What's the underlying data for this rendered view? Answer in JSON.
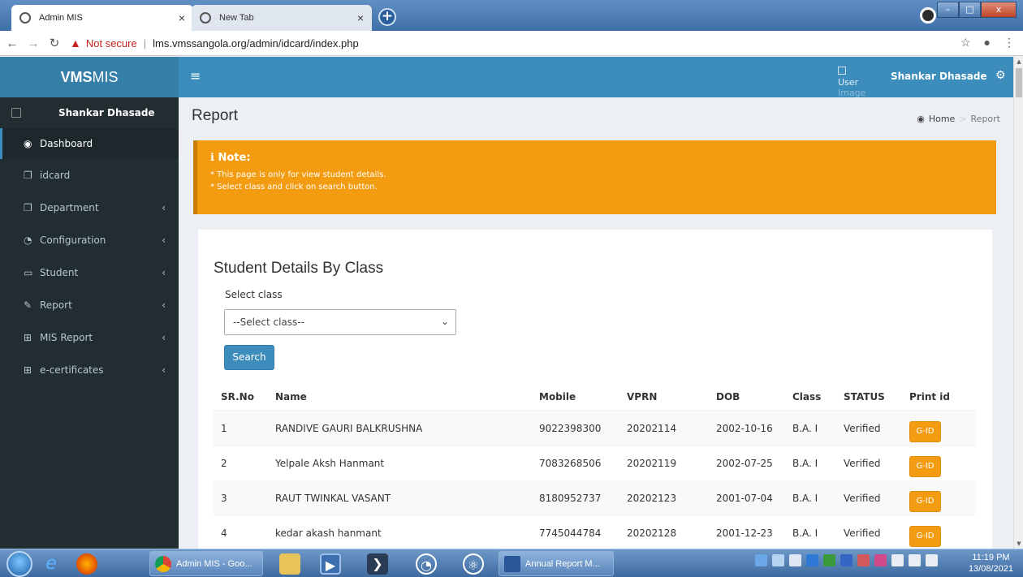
{
  "browser": {
    "tabs": [
      {
        "title": "Admin MIS",
        "active": true
      },
      {
        "title": "New Tab",
        "active": false
      }
    ],
    "address": {
      "security_label": "Not secure",
      "url": "lms.vmssangola.org/admin/idcard/index.php"
    }
  },
  "app": {
    "logo_bold": "VMS",
    "logo_rest": "MIS",
    "navbar": {
      "user_image_alt_1": "User",
      "user_image_alt_2": "Image",
      "user_name": "Shankar Dhasade"
    }
  },
  "sidebar": {
    "user_name": "Shankar Dhasade",
    "items": [
      {
        "label": "Dashboard",
        "icon": "dashboard-icon",
        "glyph": "◉",
        "active": true,
        "chevron": false
      },
      {
        "label": "idcard",
        "icon": "copy-icon",
        "glyph": "❐",
        "active": false,
        "chevron": false
      },
      {
        "label": "Department",
        "icon": "copy-icon",
        "glyph": "❐",
        "active": false,
        "chevron": true
      },
      {
        "label": "Configuration",
        "icon": "pie-chart-icon",
        "glyph": "◔",
        "active": false,
        "chevron": true
      },
      {
        "label": "Student",
        "icon": "laptop-icon",
        "glyph": "▭",
        "active": false,
        "chevron": true
      },
      {
        "label": "Report",
        "icon": "edit-icon",
        "glyph": "✎",
        "active": false,
        "chevron": true
      },
      {
        "label": "MIS Report",
        "icon": "table-icon",
        "glyph": "⊞",
        "active": false,
        "chevron": true
      },
      {
        "label": "e-certificates",
        "icon": "table-icon",
        "glyph": "⊞",
        "active": false,
        "chevron": true
      }
    ]
  },
  "page": {
    "title": "Report",
    "breadcrumb": {
      "home": "Home",
      "current": "Report"
    }
  },
  "note": {
    "title": "Note:",
    "lines": [
      "* This page is only for view student details.",
      "* Select class and click on search button."
    ]
  },
  "box": {
    "title": "Student Details By Class",
    "select_label": "Select class",
    "select_value": "--Select class--",
    "search_button": "Search"
  },
  "table": {
    "headers": [
      "SR.No",
      "Name",
      "Mobile",
      "VPRN",
      "DOB",
      "Class",
      "STATUS",
      "Print id"
    ],
    "rows": [
      {
        "sr": "1",
        "name": "RANDIVE GAURI BALKRUSHNA",
        "mobile": "9022398300",
        "vprn": "20202114",
        "dob": "2002-10-16",
        "class": "B.A. I",
        "status": "Verified",
        "action": "G-ID"
      },
      {
        "sr": "2",
        "name": "Yelpale Aksh Hanmant",
        "mobile": "7083268506",
        "vprn": "20202119",
        "dob": "2002-07-25",
        "class": "B.A. I",
        "status": "Verified",
        "action": "G-ID"
      },
      {
        "sr": "3",
        "name": "RAUT TWINKAL VASANT",
        "mobile": "8180952737",
        "vprn": "20202123",
        "dob": "2001-07-04",
        "class": "B.A. I",
        "status": "Verified",
        "action": "G-ID"
      },
      {
        "sr": "4",
        "name": "kedar akash hanmant",
        "mobile": "7745044784",
        "vprn": "20202128",
        "dob": "2001-12-23",
        "class": "B.A. I",
        "status": "Verified",
        "action": "G-ID"
      }
    ]
  },
  "taskbar": {
    "tasks": [
      {
        "label": "Admin MIS - Goo..."
      },
      {
        "label": "Annual Report M..."
      }
    ],
    "clock_time": "11:19 PM",
    "clock_date": "13/08/2021"
  },
  "colors": {
    "header_blue": "#3c8dbc",
    "logo_blue": "#367fa9",
    "sidebar_dark": "#222d32",
    "note_orange": "#f39c12"
  }
}
